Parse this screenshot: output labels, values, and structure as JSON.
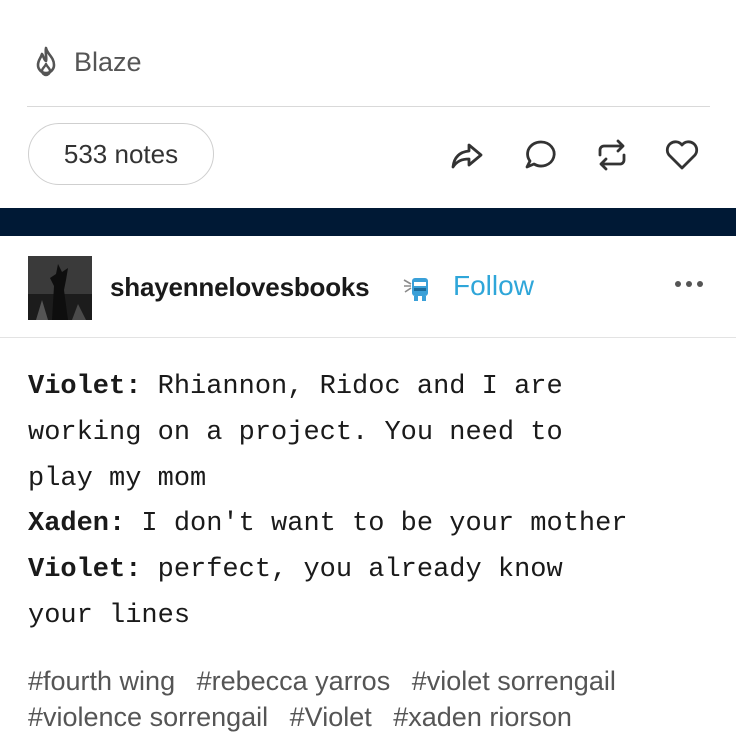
{
  "header": {
    "blaze_label": "Blaze",
    "notes_label": "533 notes"
  },
  "actions": {
    "icons": [
      "share-icon",
      "reply-icon",
      "reblog-icon",
      "like-icon"
    ]
  },
  "colors": {
    "band": "#001935",
    "follow": "#2fa6d9"
  },
  "post": {
    "username": "shayennelovesbooks",
    "follow_label": "Follow",
    "lines": [
      {
        "speaker": "Violet:",
        "text": " Rhiannon, Ridoc and I are"
      },
      {
        "speaker": "",
        "text": "working on a project. You need to"
      },
      {
        "speaker": "",
        "text": "play my mom"
      },
      {
        "speaker": "Xaden:",
        "text": " I don't want to be your mother"
      },
      {
        "speaker": "Violet:",
        "text": " perfect, you already know"
      },
      {
        "speaker": "",
        "text": "your lines"
      }
    ],
    "tags": [
      "#fourth wing",
      "#rebecca yarros",
      "#violet sorrengail",
      "#violence sorrengail",
      "#Violet",
      "#xaden riorson"
    ]
  }
}
